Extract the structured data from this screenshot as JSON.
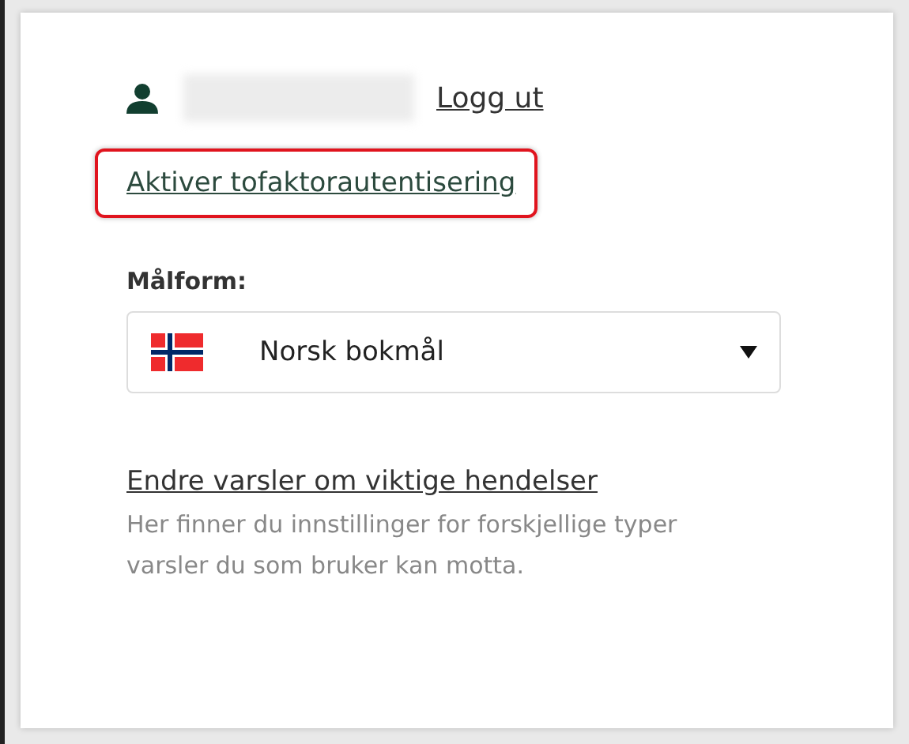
{
  "user": {
    "name_blurred": true,
    "logout": "Logg ut"
  },
  "two_factor_link": {
    "label": "Aktiver tofaktorautentisering",
    "highlighted": true
  },
  "language": {
    "label": "Målform:",
    "value": "Norsk bokmål"
  },
  "notifications": {
    "link": "Endre varsler om viktige hendelser",
    "description": "Her finner du innstillinger for forskjellige typer varsler du som bruker kan motta."
  }
}
